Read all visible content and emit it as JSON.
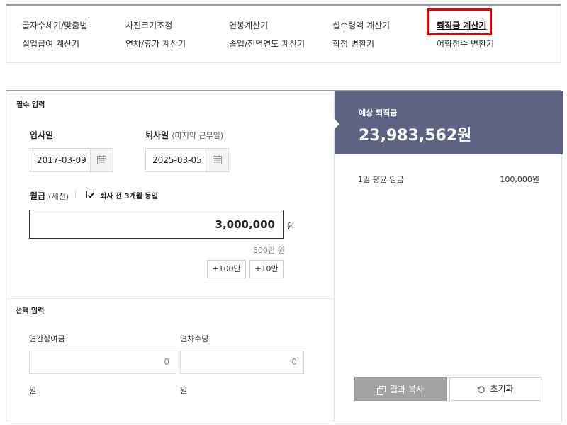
{
  "nav": {
    "row1": [
      "글자수세기/맞춤법",
      "사진크기조정",
      "연봉계산기",
      "실수령액 계산기",
      "퇴직금 계산기"
    ],
    "row2": [
      "실업급여 계산기",
      "연차/휴가 계산기",
      "졸업/전역연도 계산기",
      "학점 변환기",
      "어학점수 변환기"
    ],
    "active": "퇴직금 계산기"
  },
  "required": {
    "section_title": "필수 입력",
    "join_label": "입사일",
    "join_date": "2017-03-09",
    "leave_label": "퇴사일",
    "leave_sub": "(마지막 근무일)",
    "leave_date": "2025-03-05",
    "salary_label": "월급",
    "salary_sub": "(세전)",
    "same_3months_label": "퇴사 전 3개월 동일",
    "salary_value": "3,000,000",
    "salary_unit": "원",
    "salary_hint": "300만 원",
    "plus_100": "+100만",
    "plus_10": "+10만"
  },
  "optional": {
    "section_title": "선택 입력",
    "bonus_label": "연간상여금",
    "bonus_value": "0",
    "bonus_unit": "원",
    "allowance_label": "연차수당",
    "allowance_value": "0",
    "allowance_unit": "원"
  },
  "result": {
    "caption": "예상 퇴직금",
    "amount": "23,983,562원",
    "avg_wage_label": "1일 평균 임금",
    "avg_wage_value": "100,000원",
    "copy_button": "결과 복사",
    "reset_button": "초기화"
  },
  "colors": {
    "result_header": "#5f6383",
    "highlight": "#e60000"
  }
}
